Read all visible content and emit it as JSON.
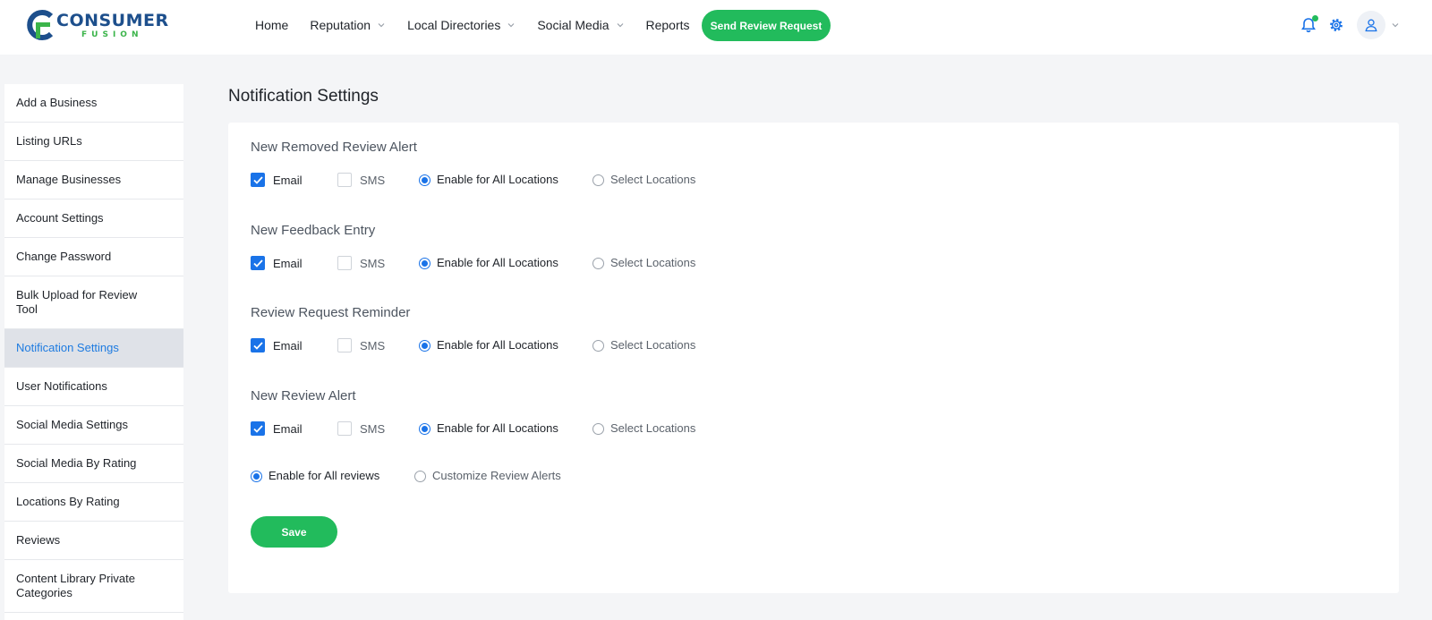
{
  "brand": {
    "name": "CONSUMER",
    "subname": "FUSION",
    "primary_color": "#1d4f8c",
    "accent_color": "#3bb44a"
  },
  "nav": {
    "items": [
      {
        "label": "Home",
        "has_dropdown": false
      },
      {
        "label": "Reputation",
        "has_dropdown": true
      },
      {
        "label": "Local Directories",
        "has_dropdown": true
      },
      {
        "label": "Social Media",
        "has_dropdown": true
      },
      {
        "label": "Reports",
        "has_dropdown": false
      }
    ],
    "cta_label": "Send Review Request",
    "icons": [
      "bell-icon",
      "gear-icon",
      "user-icon"
    ]
  },
  "sidebar": {
    "active_index": 6,
    "items": [
      {
        "label": "Add a Business"
      },
      {
        "label": "Listing URLs"
      },
      {
        "label": "Manage Businesses"
      },
      {
        "label": "Account Settings"
      },
      {
        "label": "Change Password"
      },
      {
        "label": "Bulk Upload for Review Tool"
      },
      {
        "label": "Notification Settings"
      },
      {
        "label": "User Notifications"
      },
      {
        "label": "Social Media Settings"
      },
      {
        "label": "Social Media By Rating"
      },
      {
        "label": "Locations By Rating"
      },
      {
        "label": "Reviews"
      },
      {
        "label": "Content Library Private Categories"
      }
    ]
  },
  "page": {
    "title": "Notification Settings",
    "sections": [
      {
        "title": "New Removed Review Alert",
        "email": true,
        "sms": false,
        "location_mode": "all"
      },
      {
        "title": "New Feedback Entry",
        "email": true,
        "sms": false,
        "location_mode": "all"
      },
      {
        "title": "Review Request Reminder",
        "email": true,
        "sms": false,
        "location_mode": "all"
      },
      {
        "title": "New Review Alert",
        "email": true,
        "sms": false,
        "location_mode": "all"
      }
    ],
    "labels": {
      "email": "Email",
      "sms": "SMS",
      "all_locations": "Enable for All Locations",
      "select_locations": "Select Locations"
    },
    "review_scope": {
      "all_label": "Enable for All reviews",
      "custom_label": "Customize Review Alerts",
      "selected": "all"
    },
    "save_label": "Save"
  },
  "colors": {
    "primary_blue": "#1a73e8",
    "success_green": "#22bb5c"
  }
}
